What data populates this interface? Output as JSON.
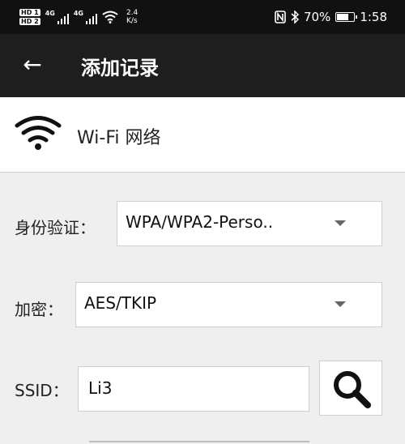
{
  "status_bar": {
    "hd1": "HD 1",
    "hd2": "HD 2",
    "signal1": "4G",
    "signal2": "4G",
    "speed_value": "2.4",
    "speed_unit": "K/s",
    "nfc_icon": "nfc-icon",
    "bluetooth_icon": "bluetooth-icon",
    "battery_percent": "70%",
    "battery_level": 0.7,
    "time": "1:58"
  },
  "app_bar": {
    "back_icon": "arrow-left-icon",
    "title": "添加记录"
  },
  "type_row": {
    "icon": "wifi-icon",
    "label": "Wi-Fi 网络"
  },
  "form": {
    "auth_label": "身份验证：",
    "auth_value": "WPA/WPA2-Perso..",
    "encrypt_label": "加密：",
    "encrypt_value": "AES/TKIP",
    "ssid_label": "SSID：",
    "ssid_value": "Li3",
    "search_icon": "search-icon"
  }
}
